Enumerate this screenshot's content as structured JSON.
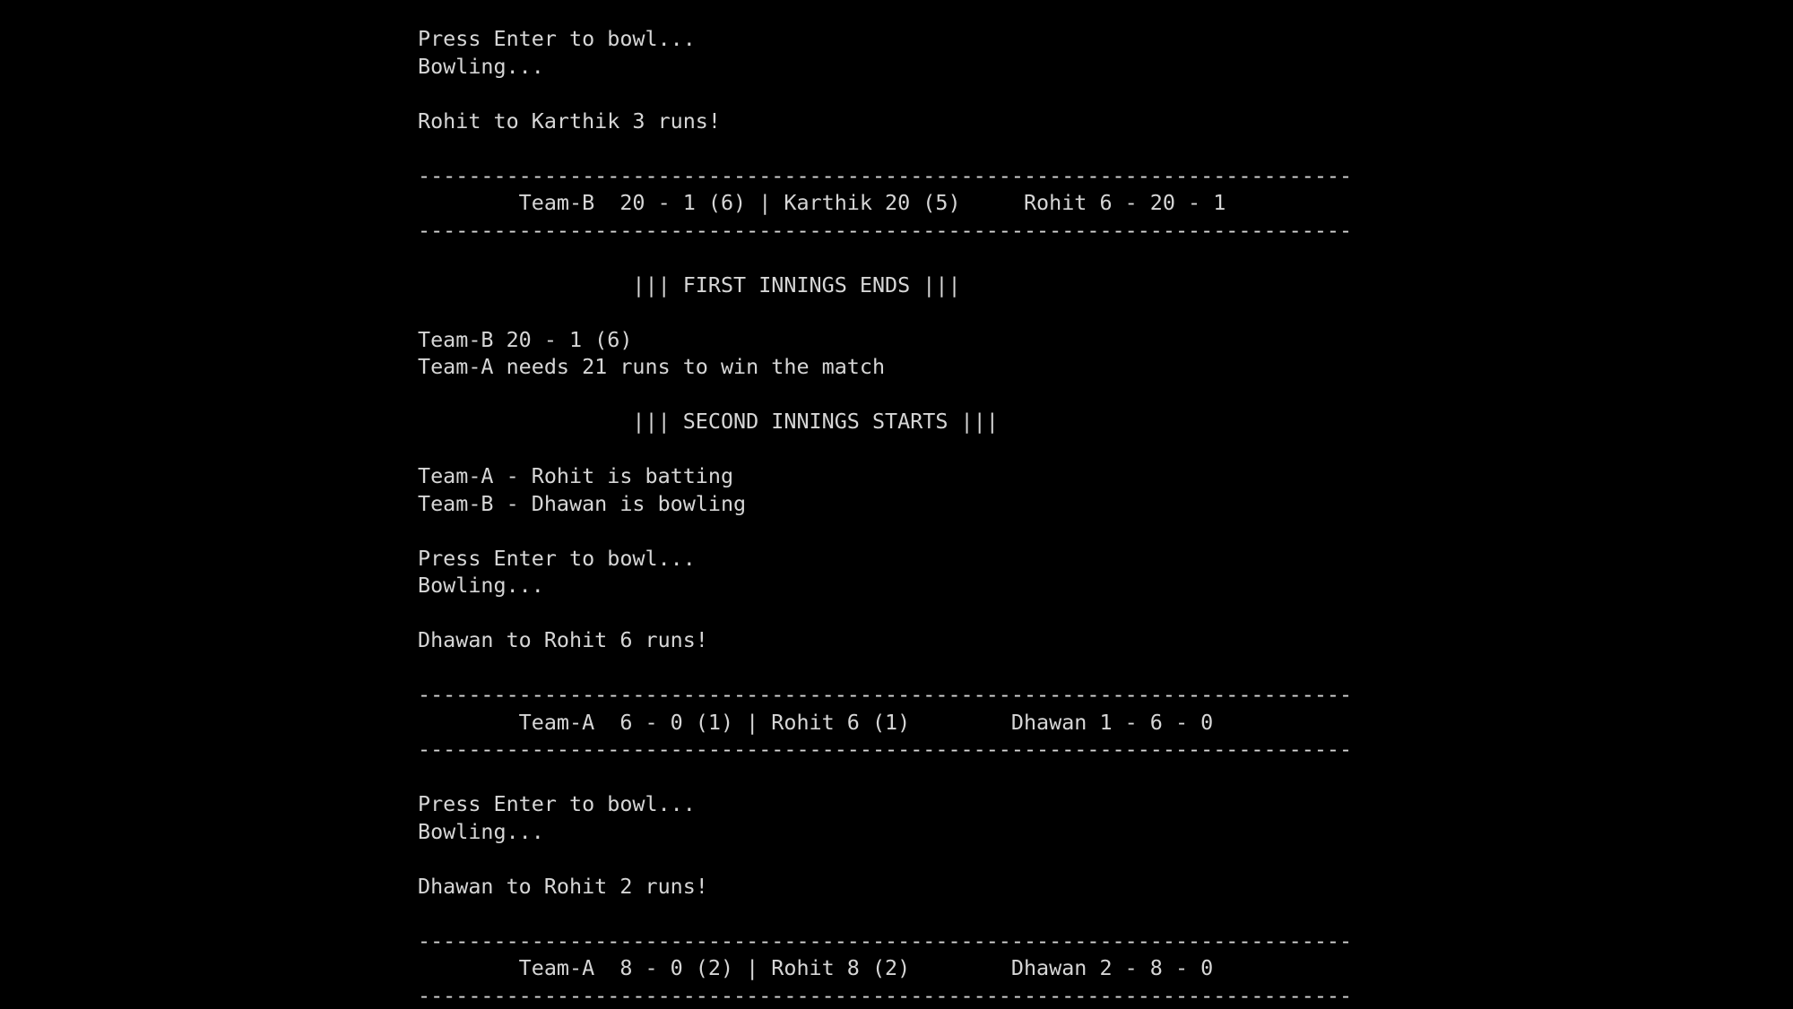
{
  "console": {
    "lines": [
      "Press Enter to bowl...",
      "Bowling...",
      "",
      "Rohit to Karthik 3 runs!",
      "",
      "--------------------------------------------------------------------------",
      "        Team-B  20 - 1 (6) | Karthik 20 (5)     Rohit 6 - 20 - 1",
      "--------------------------------------------------------------------------",
      "",
      "                 ||| FIRST INNINGS ENDS |||",
      "",
      "Team-B 20 - 1 (6)",
      "Team-A needs 21 runs to win the match",
      "",
      "                 ||| SECOND INNINGS STARTS |||",
      "",
      "Team-A - Rohit is batting",
      "Team-B - Dhawan is bowling",
      "",
      "Press Enter to bowl...",
      "Bowling...",
      "",
      "Dhawan to Rohit 6 runs!",
      "",
      "--------------------------------------------------------------------------",
      "        Team-A  6 - 0 (1) | Rohit 6 (1)        Dhawan 1 - 6 - 0",
      "--------------------------------------------------------------------------",
      "",
      "Press Enter to bowl...",
      "Bowling...",
      "",
      "Dhawan to Rohit 2 runs!",
      "",
      "--------------------------------------------------------------------------",
      "        Team-A  8 - 0 (2) | Rohit 8 (2)        Dhawan 2 - 8 - 0",
      "--------------------------------------------------------------------------"
    ]
  },
  "colors": {
    "background": "#000000",
    "text": "#d6d6d6"
  }
}
